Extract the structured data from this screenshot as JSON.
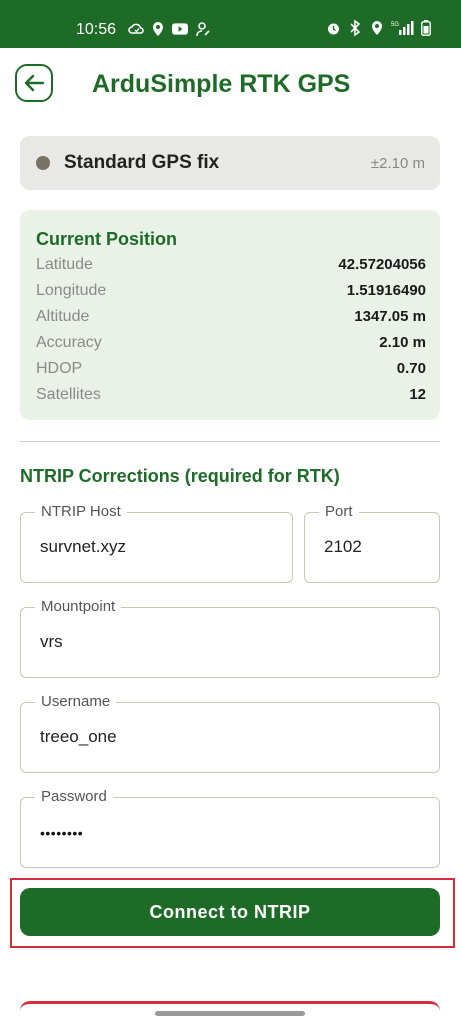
{
  "status_bar": {
    "time": "10:56",
    "left_icons": [
      "cloud-sync-icon",
      "location-badge-icon",
      "youtube-icon",
      "person-icon"
    ],
    "right_icons": [
      "alarm-icon",
      "bluetooth-icon",
      "location-icon",
      "signal-5g-icon",
      "battery-icon"
    ]
  },
  "header": {
    "title": "ArduSimple RTK GPS",
    "back_icon": "arrow-left-icon"
  },
  "fix_status": {
    "label": "Standard GPS fix",
    "accuracy": "±2.10 m",
    "dot_color": "#777263"
  },
  "position": {
    "title": "Current Position",
    "rows": [
      {
        "label": "Latitude",
        "value": "42.57204056"
      },
      {
        "label": "Longitude",
        "value": "1.51916490"
      },
      {
        "label": "Altitude",
        "value": "1347.05 m"
      },
      {
        "label": "Accuracy",
        "value": "2.10 m"
      },
      {
        "label": "HDOP",
        "value": "0.70"
      },
      {
        "label": "Satellites",
        "value": "12"
      }
    ]
  },
  "ntrip": {
    "title": "NTRIP Corrections (required for RTK)",
    "host": {
      "label": "NTRIP Host",
      "value": "survnet.xyz"
    },
    "port": {
      "label": "Port",
      "value": "2102"
    },
    "mountpoint": {
      "label": "Mountpoint",
      "value": "vrs"
    },
    "username": {
      "label": "Username",
      "value": "treeo_one"
    },
    "password": {
      "label": "Password",
      "value": "••••••••"
    },
    "connect_label": "Connect to NTRIP"
  },
  "colors": {
    "brand": "#1e6b28",
    "highlight": "#d1303a"
  }
}
